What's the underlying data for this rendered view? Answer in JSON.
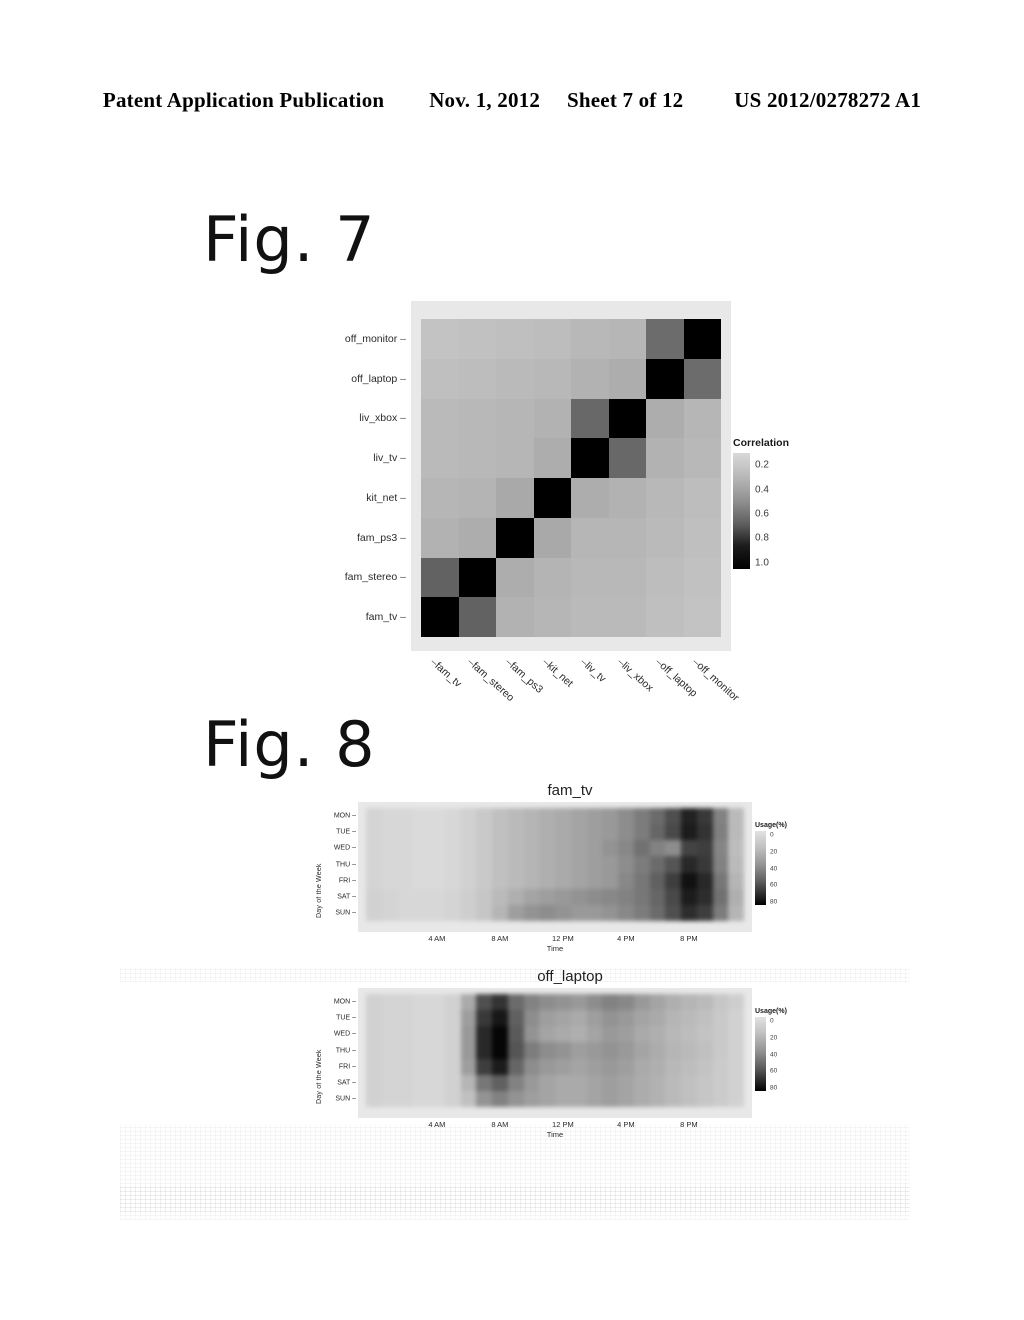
{
  "header": {
    "publication": "Patent Application Publication",
    "date": "Nov. 1, 2012",
    "sheet": "Sheet 7 of 12",
    "patent_number": "US 2012/0278272 A1"
  },
  "figures": {
    "fig7_label": "Fig. 7",
    "fig8_label": "Fig. 8"
  },
  "chart_data": [
    {
      "type": "heatmap",
      "figure": "Fig. 7",
      "title": "",
      "xlabel": "",
      "ylabel": "",
      "legend_title": "Correlation",
      "legend_position": "right",
      "legend_ticks": [
        "0.2",
        "0.4",
        "0.6",
        "0.8",
        "1.0"
      ],
      "colorscale": [
        "#d9d9d9",
        "#000000"
      ],
      "zlim": [
        0.0,
        1.0
      ],
      "categories": [
        "fam_tv",
        "fam_stereo",
        "fam_ps3",
        "kit_net",
        "liv_tv",
        "liv_xbox",
        "off_laptop",
        "off_monitor"
      ],
      "y_categories_top_to_bottom": [
        "off_monitor",
        "off_laptop",
        "liv_xbox",
        "liv_tv",
        "kit_net",
        "fam_ps3",
        "fam_stereo",
        "fam_tv"
      ],
      "matrix": [
        [
          1.0,
          0.55,
          0.18,
          0.16,
          0.14,
          0.14,
          0.12,
          0.1
        ],
        [
          0.55,
          1.0,
          0.2,
          0.17,
          0.15,
          0.15,
          0.13,
          0.11
        ],
        [
          0.18,
          0.2,
          1.0,
          0.22,
          0.16,
          0.16,
          0.14,
          0.12
        ],
        [
          0.16,
          0.17,
          0.22,
          1.0,
          0.2,
          0.18,
          0.15,
          0.13
        ],
        [
          0.14,
          0.15,
          0.16,
          0.2,
          1.0,
          0.52,
          0.18,
          0.15
        ],
        [
          0.14,
          0.15,
          0.16,
          0.18,
          0.52,
          1.0,
          0.2,
          0.16
        ],
        [
          0.12,
          0.13,
          0.14,
          0.15,
          0.18,
          0.2,
          1.0,
          0.5
        ],
        [
          0.1,
          0.11,
          0.12,
          0.13,
          0.15,
          0.16,
          0.5,
          1.0
        ]
      ]
    },
    {
      "type": "heatmap",
      "figure": "Fig. 8a",
      "title": "fam_tv",
      "xlabel": "Time",
      "ylabel": "Day of the Week",
      "legend_title": "Usage(%)",
      "legend_position": "right",
      "legend_ticks": [
        "0",
        "20",
        "40",
        "60",
        "80"
      ],
      "colorscale": [
        "#e2e2e2",
        "#000000"
      ],
      "zlim": [
        0,
        80
      ],
      "x_tick_labels": [
        "4 AM",
        "8 AM",
        "12 PM",
        "4 PM",
        "8 PM"
      ],
      "y_tick_labels": [
        "MON",
        "TUE",
        "WED",
        "THU",
        "FRI",
        "SAT",
        "SUN"
      ],
      "hours": [
        0,
        1,
        2,
        3,
        4,
        5,
        6,
        7,
        8,
        9,
        10,
        11,
        12,
        13,
        14,
        15,
        16,
        17,
        18,
        19,
        20,
        21,
        22,
        23
      ],
      "values": [
        [
          5,
          4,
          4,
          3,
          3,
          4,
          6,
          9,
          12,
          14,
          16,
          18,
          20,
          22,
          24,
          26,
          30,
          36,
          42,
          52,
          68,
          60,
          34,
          14
        ],
        [
          5,
          4,
          4,
          3,
          3,
          4,
          6,
          9,
          12,
          14,
          16,
          18,
          20,
          22,
          24,
          26,
          30,
          36,
          44,
          54,
          70,
          62,
          35,
          14
        ],
        [
          5,
          4,
          4,
          3,
          3,
          4,
          6,
          9,
          12,
          14,
          16,
          18,
          20,
          22,
          24,
          28,
          32,
          40,
          34,
          30,
          56,
          58,
          33,
          13
        ],
        [
          5,
          4,
          4,
          3,
          3,
          4,
          6,
          9,
          12,
          14,
          16,
          18,
          20,
          22,
          24,
          26,
          30,
          36,
          42,
          50,
          66,
          60,
          34,
          14
        ],
        [
          5,
          4,
          4,
          3,
          3,
          4,
          6,
          9,
          12,
          14,
          16,
          18,
          20,
          22,
          24,
          26,
          32,
          38,
          46,
          58,
          74,
          66,
          38,
          16
        ],
        [
          6,
          5,
          4,
          4,
          4,
          5,
          7,
          10,
          14,
          18,
          22,
          24,
          26,
          28,
          30,
          32,
          34,
          38,
          44,
          54,
          70,
          64,
          40,
          18
        ],
        [
          6,
          5,
          4,
          4,
          4,
          5,
          7,
          10,
          16,
          24,
          28,
          30,
          28,
          26,
          26,
          28,
          32,
          36,
          42,
          52,
          64,
          58,
          36,
          16
        ]
      ]
    },
    {
      "type": "heatmap",
      "figure": "Fig. 8b",
      "title": "off_laptop",
      "xlabel": "Time",
      "ylabel": "Day of the Week",
      "legend_title": "Usage(%)",
      "legend_position": "right",
      "legend_ticks": [
        "0",
        "20",
        "40",
        "60",
        "80"
      ],
      "colorscale": [
        "#e2e2e2",
        "#000000"
      ],
      "zlim": [
        0,
        80
      ],
      "x_tick_labels": [
        "4 AM",
        "8 AM",
        "12 PM",
        "4 PM",
        "8 PM"
      ],
      "y_tick_labels": [
        "MON",
        "TUE",
        "WED",
        "THU",
        "FRI",
        "SAT",
        "SUN"
      ],
      "hours": [
        0,
        1,
        2,
        3,
        4,
        5,
        6,
        7,
        8,
        9,
        10,
        11,
        12,
        13,
        14,
        15,
        16,
        17,
        18,
        19,
        20,
        21,
        22,
        23
      ],
      "values": [
        [
          6,
          5,
          5,
          4,
          4,
          6,
          20,
          52,
          62,
          42,
          34,
          30,
          28,
          26,
          30,
          34,
          32,
          26,
          22,
          18,
          16,
          14,
          10,
          7
        ],
        [
          6,
          5,
          5,
          4,
          4,
          6,
          24,
          60,
          72,
          46,
          30,
          24,
          22,
          20,
          24,
          28,
          26,
          22,
          20,
          16,
          14,
          12,
          9,
          6
        ],
        [
          6,
          5,
          5,
          4,
          4,
          6,
          26,
          66,
          78,
          48,
          28,
          22,
          20,
          18,
          22,
          26,
          24,
          20,
          18,
          15,
          13,
          11,
          9,
          6
        ],
        [
          6,
          5,
          5,
          4,
          4,
          6,
          26,
          66,
          78,
          50,
          36,
          30,
          28,
          24,
          26,
          28,
          26,
          22,
          19,
          16,
          14,
          12,
          9,
          6
        ],
        [
          6,
          5,
          5,
          4,
          4,
          6,
          24,
          58,
          70,
          44,
          30,
          26,
          24,
          22,
          24,
          26,
          24,
          20,
          18,
          15,
          13,
          11,
          8,
          6
        ],
        [
          6,
          5,
          5,
          4,
          4,
          6,
          16,
          38,
          46,
          34,
          26,
          22,
          20,
          20,
          22,
          24,
          22,
          19,
          17,
          14,
          12,
          10,
          8,
          6
        ],
        [
          6,
          5,
          5,
          4,
          4,
          6,
          12,
          28,
          34,
          28,
          24,
          22,
          20,
          20,
          22,
          24,
          22,
          19,
          17,
          14,
          12,
          10,
          8,
          6
        ]
      ]
    }
  ]
}
